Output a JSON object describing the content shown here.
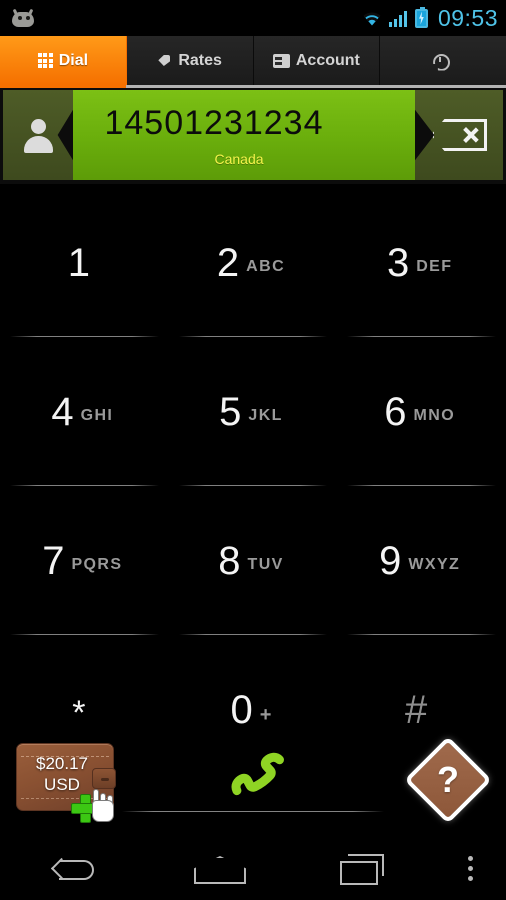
{
  "status_bar": {
    "notification_icon": "android-robot-icon",
    "wifi_icon": "wifi-icon",
    "signal_icon": "cellular-signal-icon",
    "battery_icon": "battery-charging-icon",
    "time": "09:53",
    "accent_color": "#4fc3e8"
  },
  "tabs": [
    {
      "label": "Dial",
      "icon": "keypad-grid-icon",
      "active": true
    },
    {
      "label": "Rates",
      "icon": "price-tag-icon",
      "active": false
    },
    {
      "label": "Account",
      "icon": "account-card-icon",
      "active": false
    },
    {
      "label": "",
      "icon": "history-icon",
      "active": false
    }
  ],
  "display": {
    "avatar_icon": "contact-person-icon",
    "number": "14501231234",
    "country": "Canada",
    "backspace_icon": "backspace-delete-icon",
    "field_color": "#6aae0c",
    "country_color": "#f3f24a"
  },
  "keypad": [
    {
      "digit": "1",
      "letters": ""
    },
    {
      "digit": "2",
      "letters": "ABC"
    },
    {
      "digit": "3",
      "letters": "DEF"
    },
    {
      "digit": "4",
      "letters": "GHI"
    },
    {
      "digit": "5",
      "letters": "JKL"
    },
    {
      "digit": "6",
      "letters": "MNO"
    },
    {
      "digit": "7",
      "letters": "PQRS"
    },
    {
      "digit": "8",
      "letters": "TUV"
    },
    {
      "digit": "9",
      "letters": "WXYZ"
    },
    {
      "digit": "*",
      "letters": ""
    },
    {
      "digit": "0",
      "letters": "+"
    },
    {
      "digit": "#",
      "letters": ""
    }
  ],
  "action_bar": {
    "wallet": {
      "icon": "wallet-icon",
      "balance": "$20.17",
      "currency": "USD",
      "add_badge_icon": "add-plus-icon",
      "cursor_icon": "hand-cursor-icon"
    },
    "call_button": {
      "icon": "call-handset-icon",
      "color": "#8fd424"
    },
    "help_button": {
      "icon": "help-question-icon",
      "label": "?",
      "color": "#8d5739"
    }
  },
  "nav_bar": {
    "back": "back-icon",
    "home": "home-icon",
    "recents": "recent-apps-icon",
    "overflow": "overflow-menu-icon"
  }
}
